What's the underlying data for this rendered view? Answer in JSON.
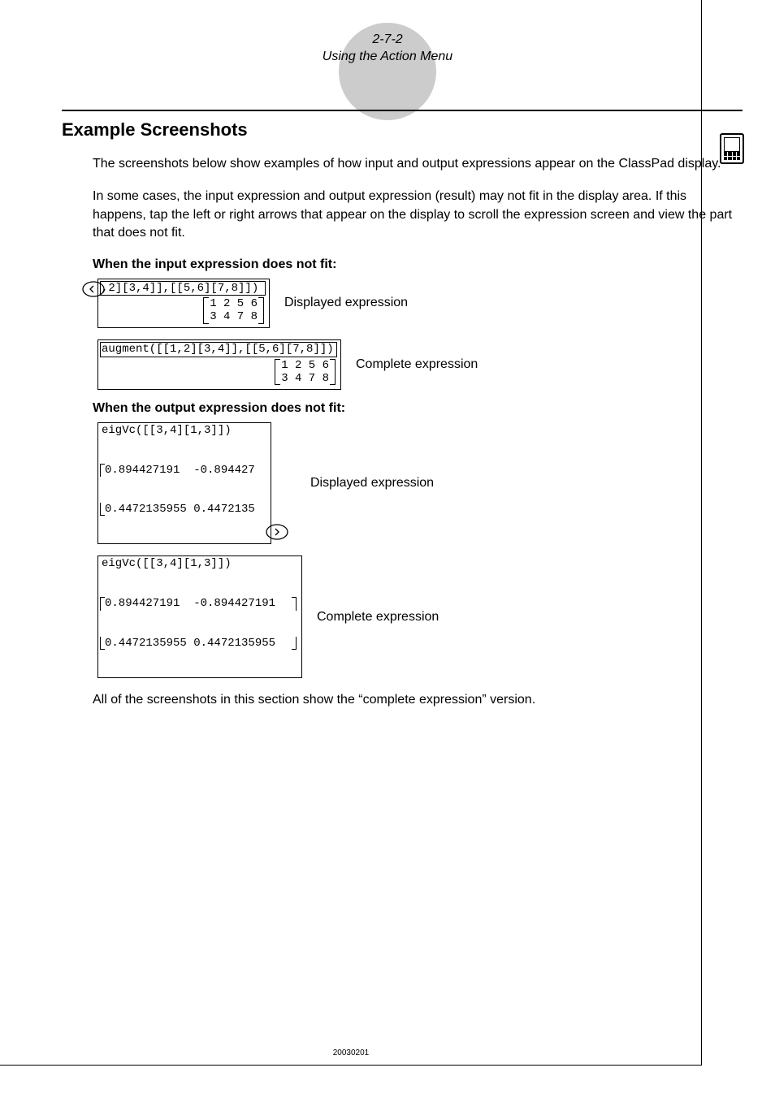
{
  "header": {
    "page_num": "2-7-2",
    "subtitle": "Using the Action Menu"
  },
  "section": {
    "title": "Example Screenshots",
    "para1": "The screenshots below show examples of how input and output expressions appear on the ClassPad display.",
    "para2": "In some cases, the input expression and output expression (result) may not fit in the display area. If this happens, tap the left or right arrows that appear on the display to scroll the expression screen and view the part that does not fit.",
    "sub1": "When the input expression does not fit:",
    "ex1": {
      "displayed_input": ",2][3,4]],[[5,6][7,8]])",
      "displayed_matrix_r1": "1 2 5 6",
      "displayed_matrix_r2": "3 4 7 8",
      "displayed_label": "Displayed expression",
      "complete_input": "augment([[1,2][3,4]],[[5,6][7,8]])",
      "complete_matrix_r1": "1 2 5 6",
      "complete_matrix_r2": "3 4 7 8",
      "complete_label": "Complete expression"
    },
    "sub2": "When the output expression does not fit:",
    "ex2": {
      "displayed_input": "eigVc([[3,4][1,3]])",
      "displayed_r1": "0.894427191  -0.894427",
      "displayed_r2": "0.4472135955 0.4472135",
      "displayed_label": "Displayed expression",
      "complete_input": "eigVc([[3,4][1,3]])",
      "complete_r1": "0.894427191  -0.894427191",
      "complete_r2": "0.4472135955 0.4472135955",
      "complete_label": "Complete expression"
    },
    "footer_text": "All of the screenshots in this section show the “complete expression” version."
  },
  "page_code": "20030201"
}
